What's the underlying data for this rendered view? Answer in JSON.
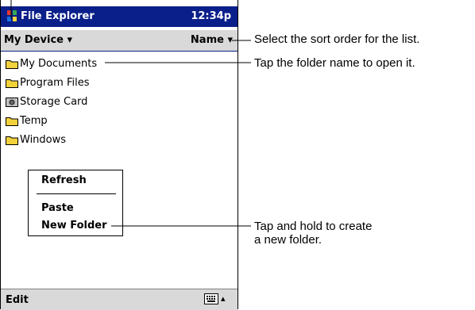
{
  "title_bar": {
    "app_title": "File Explorer",
    "clock": "12:34p"
  },
  "toolbar": {
    "location_menu": "My Device",
    "sort_menu": "Name"
  },
  "file_list": [
    {
      "name": "My Documents",
      "icon": "folder-icon"
    },
    {
      "name": "Program Files",
      "icon": "folder-icon"
    },
    {
      "name": "Storage Card",
      "icon": "storage-card-icon"
    },
    {
      "name": "Temp",
      "icon": "folder-icon"
    },
    {
      "name": "Windows",
      "icon": "folder-icon"
    }
  ],
  "context_menu": {
    "items": [
      "Refresh",
      "Paste",
      "New Folder"
    ]
  },
  "bottom_bar": {
    "edit_menu": "Edit",
    "input_icon": "keyboard-icon",
    "input_arrow_icon": "arrow-up-icon"
  },
  "callouts": [
    "Select the sort order for the list.",
    "Tap the folder name to open it.",
    "Tap and hold to create\na new folder."
  ],
  "colors": {
    "title_bar": "#0a1f8a",
    "bars": "#d9d9d9",
    "folder_fill": "#f2d23a"
  }
}
